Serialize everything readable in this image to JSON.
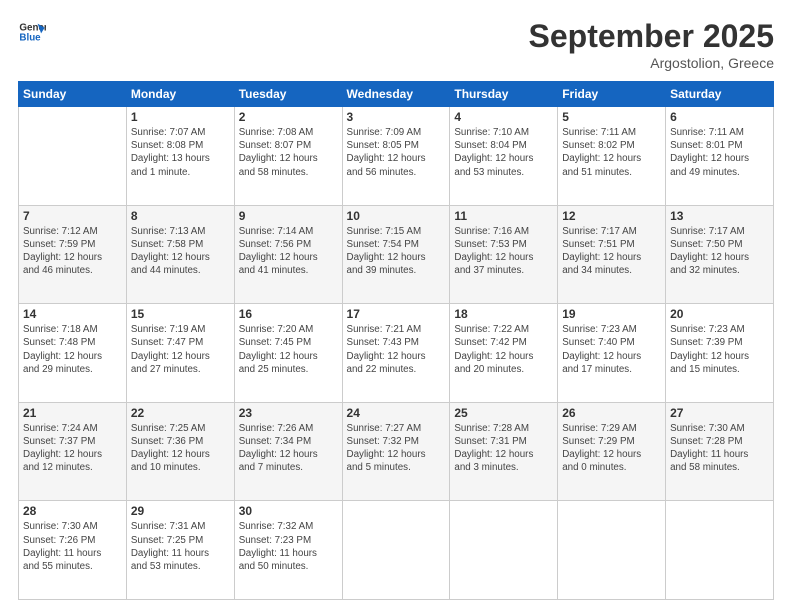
{
  "logo": {
    "line1": "General",
    "line2": "Blue"
  },
  "title": "September 2025",
  "location": "Argostolion, Greece",
  "days_of_week": [
    "Sunday",
    "Monday",
    "Tuesday",
    "Wednesday",
    "Thursday",
    "Friday",
    "Saturday"
  ],
  "weeks": [
    [
      {
        "day": "",
        "info": ""
      },
      {
        "day": "1",
        "info": "Sunrise: 7:07 AM\nSunset: 8:08 PM\nDaylight: 13 hours\nand 1 minute."
      },
      {
        "day": "2",
        "info": "Sunrise: 7:08 AM\nSunset: 8:07 PM\nDaylight: 12 hours\nand 58 minutes."
      },
      {
        "day": "3",
        "info": "Sunrise: 7:09 AM\nSunset: 8:05 PM\nDaylight: 12 hours\nand 56 minutes."
      },
      {
        "day": "4",
        "info": "Sunrise: 7:10 AM\nSunset: 8:04 PM\nDaylight: 12 hours\nand 53 minutes."
      },
      {
        "day": "5",
        "info": "Sunrise: 7:11 AM\nSunset: 8:02 PM\nDaylight: 12 hours\nand 51 minutes."
      },
      {
        "day": "6",
        "info": "Sunrise: 7:11 AM\nSunset: 8:01 PM\nDaylight: 12 hours\nand 49 minutes."
      }
    ],
    [
      {
        "day": "7",
        "info": "Sunrise: 7:12 AM\nSunset: 7:59 PM\nDaylight: 12 hours\nand 46 minutes."
      },
      {
        "day": "8",
        "info": "Sunrise: 7:13 AM\nSunset: 7:58 PM\nDaylight: 12 hours\nand 44 minutes."
      },
      {
        "day": "9",
        "info": "Sunrise: 7:14 AM\nSunset: 7:56 PM\nDaylight: 12 hours\nand 41 minutes."
      },
      {
        "day": "10",
        "info": "Sunrise: 7:15 AM\nSunset: 7:54 PM\nDaylight: 12 hours\nand 39 minutes."
      },
      {
        "day": "11",
        "info": "Sunrise: 7:16 AM\nSunset: 7:53 PM\nDaylight: 12 hours\nand 37 minutes."
      },
      {
        "day": "12",
        "info": "Sunrise: 7:17 AM\nSunset: 7:51 PM\nDaylight: 12 hours\nand 34 minutes."
      },
      {
        "day": "13",
        "info": "Sunrise: 7:17 AM\nSunset: 7:50 PM\nDaylight: 12 hours\nand 32 minutes."
      }
    ],
    [
      {
        "day": "14",
        "info": "Sunrise: 7:18 AM\nSunset: 7:48 PM\nDaylight: 12 hours\nand 29 minutes."
      },
      {
        "day": "15",
        "info": "Sunrise: 7:19 AM\nSunset: 7:47 PM\nDaylight: 12 hours\nand 27 minutes."
      },
      {
        "day": "16",
        "info": "Sunrise: 7:20 AM\nSunset: 7:45 PM\nDaylight: 12 hours\nand 25 minutes."
      },
      {
        "day": "17",
        "info": "Sunrise: 7:21 AM\nSunset: 7:43 PM\nDaylight: 12 hours\nand 22 minutes."
      },
      {
        "day": "18",
        "info": "Sunrise: 7:22 AM\nSunset: 7:42 PM\nDaylight: 12 hours\nand 20 minutes."
      },
      {
        "day": "19",
        "info": "Sunrise: 7:23 AM\nSunset: 7:40 PM\nDaylight: 12 hours\nand 17 minutes."
      },
      {
        "day": "20",
        "info": "Sunrise: 7:23 AM\nSunset: 7:39 PM\nDaylight: 12 hours\nand 15 minutes."
      }
    ],
    [
      {
        "day": "21",
        "info": "Sunrise: 7:24 AM\nSunset: 7:37 PM\nDaylight: 12 hours\nand 12 minutes."
      },
      {
        "day": "22",
        "info": "Sunrise: 7:25 AM\nSunset: 7:36 PM\nDaylight: 12 hours\nand 10 minutes."
      },
      {
        "day": "23",
        "info": "Sunrise: 7:26 AM\nSunset: 7:34 PM\nDaylight: 12 hours\nand 7 minutes."
      },
      {
        "day": "24",
        "info": "Sunrise: 7:27 AM\nSunset: 7:32 PM\nDaylight: 12 hours\nand 5 minutes."
      },
      {
        "day": "25",
        "info": "Sunrise: 7:28 AM\nSunset: 7:31 PM\nDaylight: 12 hours\nand 3 minutes."
      },
      {
        "day": "26",
        "info": "Sunrise: 7:29 AM\nSunset: 7:29 PM\nDaylight: 12 hours\nand 0 minutes."
      },
      {
        "day": "27",
        "info": "Sunrise: 7:30 AM\nSunset: 7:28 PM\nDaylight: 11 hours\nand 58 minutes."
      }
    ],
    [
      {
        "day": "28",
        "info": "Sunrise: 7:30 AM\nSunset: 7:26 PM\nDaylight: 11 hours\nand 55 minutes."
      },
      {
        "day": "29",
        "info": "Sunrise: 7:31 AM\nSunset: 7:25 PM\nDaylight: 11 hours\nand 53 minutes."
      },
      {
        "day": "30",
        "info": "Sunrise: 7:32 AM\nSunset: 7:23 PM\nDaylight: 11 hours\nand 50 minutes."
      },
      {
        "day": "",
        "info": ""
      },
      {
        "day": "",
        "info": ""
      },
      {
        "day": "",
        "info": ""
      },
      {
        "day": "",
        "info": ""
      }
    ]
  ]
}
